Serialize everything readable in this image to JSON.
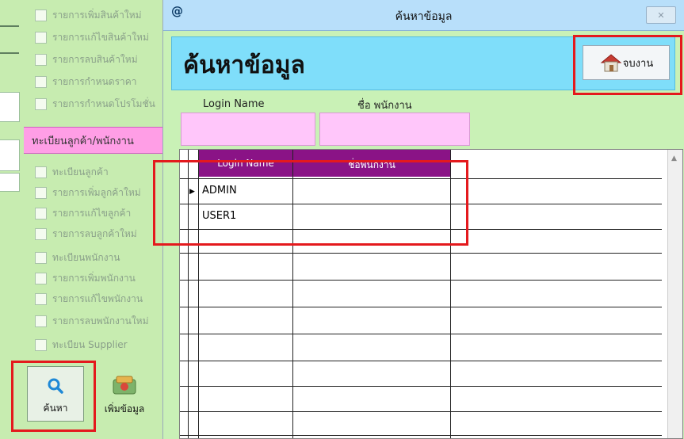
{
  "background": {
    "menu_items_top": [
      "รายการเพิ่มสินค้าใหม่",
      "รายการแก้ไขสินค้าใหม่",
      "รายการลบสินค้าใหม่",
      "รายการกำหนดราคา",
      "รายการกำหนดโปรโมชั่น"
    ],
    "section_header": "ทะเบียนลูกค้า/พนักงาน",
    "menu_items_bottom": [
      "ทะเบียนลูกค้า",
      "รายการเพิ่มลูกค้าใหม่",
      "รายการแก้ไขลูกค้า",
      "รายการลบลูกค้าใหม่",
      "ทะเบียนพนักงาน",
      "รายการเพิ่มพนักงาน",
      "รายการแก้ไขพนักงาน",
      "รายการลบพนักงานใหม่",
      "ทะเบียน Supplier"
    ],
    "search_button": "ค้นหา",
    "add_button": "เพิ่มข้อมูล"
  },
  "dialog": {
    "title": "ค้นหาข้อมูล",
    "icon_text": "@",
    "close_glyph": "✕",
    "heading": "ค้นหาข้อมูล",
    "exit_label": "จบงาน",
    "label_login": "Login Name",
    "label_employee": "ชื่อ พนักงาน",
    "login_value": "",
    "employee_value": "",
    "grid": {
      "columns": [
        "Login Name",
        "ชื่อพนักงาน"
      ],
      "rows": [
        {
          "login": "ADMIN",
          "name": ""
        },
        {
          "login": "USER1",
          "name": ""
        }
      ]
    }
  },
  "colors": {
    "highlight": "#e4191d",
    "grid_header": "#8a1386",
    "field": "#ffc6fa",
    "header_bar": "#7fdefa",
    "background": "#c7ecb0"
  }
}
